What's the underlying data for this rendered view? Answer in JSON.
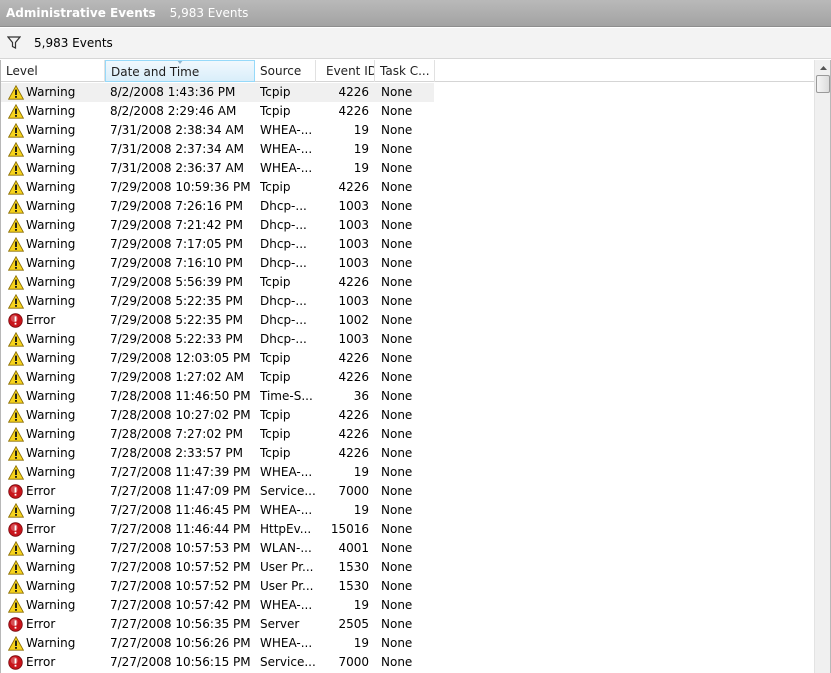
{
  "window": {
    "title": "Administrative Events",
    "event_count": "5,983 Events"
  },
  "filterbar": {
    "icon": "filter-icon",
    "count_label": "5,983 Events"
  },
  "table": {
    "columns": [
      "Level",
      "Date and Time",
      "Source",
      "Event ID",
      "Task C..."
    ],
    "sorted_column": "Date and Time",
    "rows": [
      {
        "level": "Warning",
        "date": "8/2/2008 1:43:36 PM",
        "source": "Tcpip",
        "id": "4226",
        "task": "None"
      },
      {
        "level": "Warning",
        "date": "8/2/2008 2:29:46 AM",
        "source": "Tcpip",
        "id": "4226",
        "task": "None"
      },
      {
        "level": "Warning",
        "date": "7/31/2008 2:38:34 AM",
        "source": "WHEA-...",
        "id": "19",
        "task": "None"
      },
      {
        "level": "Warning",
        "date": "7/31/2008 2:37:34 AM",
        "source": "WHEA-...",
        "id": "19",
        "task": "None"
      },
      {
        "level": "Warning",
        "date": "7/31/2008 2:36:37 AM",
        "source": "WHEA-...",
        "id": "19",
        "task": "None"
      },
      {
        "level": "Warning",
        "date": "7/29/2008 10:59:36 PM",
        "source": "Tcpip",
        "id": "4226",
        "task": "None"
      },
      {
        "level": "Warning",
        "date": "7/29/2008 7:26:16 PM",
        "source": "Dhcp-...",
        "id": "1003",
        "task": "None"
      },
      {
        "level": "Warning",
        "date": "7/29/2008 7:21:42 PM",
        "source": "Dhcp-...",
        "id": "1003",
        "task": "None"
      },
      {
        "level": "Warning",
        "date": "7/29/2008 7:17:05 PM",
        "source": "Dhcp-...",
        "id": "1003",
        "task": "None"
      },
      {
        "level": "Warning",
        "date": "7/29/2008 7:16:10 PM",
        "source": "Dhcp-...",
        "id": "1003",
        "task": "None"
      },
      {
        "level": "Warning",
        "date": "7/29/2008 5:56:39 PM",
        "source": "Tcpip",
        "id": "4226",
        "task": "None"
      },
      {
        "level": "Warning",
        "date": "7/29/2008 5:22:35 PM",
        "source": "Dhcp-...",
        "id": "1003",
        "task": "None"
      },
      {
        "level": "Error",
        "date": "7/29/2008 5:22:35 PM",
        "source": "Dhcp-...",
        "id": "1002",
        "task": "None"
      },
      {
        "level": "Warning",
        "date": "7/29/2008 5:22:33 PM",
        "source": "Dhcp-...",
        "id": "1003",
        "task": "None"
      },
      {
        "level": "Warning",
        "date": "7/29/2008 12:03:05 PM",
        "source": "Tcpip",
        "id": "4226",
        "task": "None"
      },
      {
        "level": "Warning",
        "date": "7/29/2008 1:27:02 AM",
        "source": "Tcpip",
        "id": "4226",
        "task": "None"
      },
      {
        "level": "Warning",
        "date": "7/28/2008 11:46:50 PM",
        "source": "Time-S...",
        "id": "36",
        "task": "None"
      },
      {
        "level": "Warning",
        "date": "7/28/2008 10:27:02 PM",
        "source": "Tcpip",
        "id": "4226",
        "task": "None"
      },
      {
        "level": "Warning",
        "date": "7/28/2008 7:27:02 PM",
        "source": "Tcpip",
        "id": "4226",
        "task": "None"
      },
      {
        "level": "Warning",
        "date": "7/28/2008 2:33:57 PM",
        "source": "Tcpip",
        "id": "4226",
        "task": "None"
      },
      {
        "level": "Warning",
        "date": "7/27/2008 11:47:39 PM",
        "source": "WHEA-...",
        "id": "19",
        "task": "None"
      },
      {
        "level": "Error",
        "date": "7/27/2008 11:47:09 PM",
        "source": "Service...",
        "id": "7000",
        "task": "None"
      },
      {
        "level": "Warning",
        "date": "7/27/2008 11:46:45 PM",
        "source": "WHEA-...",
        "id": "19",
        "task": "None"
      },
      {
        "level": "Error",
        "date": "7/27/2008 11:46:44 PM",
        "source": "HttpEv...",
        "id": "15016",
        "task": "None"
      },
      {
        "level": "Warning",
        "date": "7/27/2008 10:57:53 PM",
        "source": "WLAN-...",
        "id": "4001",
        "task": "None"
      },
      {
        "level": "Warning",
        "date": "7/27/2008 10:57:52 PM",
        "source": "User Pr...",
        "id": "1530",
        "task": "None"
      },
      {
        "level": "Warning",
        "date": "7/27/2008 10:57:52 PM",
        "source": "User Pr...",
        "id": "1530",
        "task": "None"
      },
      {
        "level": "Warning",
        "date": "7/27/2008 10:57:42 PM",
        "source": "WHEA-...",
        "id": "19",
        "task": "None"
      },
      {
        "level": "Error",
        "date": "7/27/2008 10:56:35 PM",
        "source": "Server",
        "id": "2505",
        "task": "None"
      },
      {
        "level": "Warning",
        "date": "7/27/2008 10:56:26 PM",
        "source": "WHEA-...",
        "id": "19",
        "task": "None"
      },
      {
        "level": "Error",
        "date": "7/27/2008 10:56:15 PM",
        "source": "Service...",
        "id": "7000",
        "task": "None"
      }
    ]
  },
  "colors": {
    "warning": "#f6d31d",
    "error": "#c8141b",
    "sorted_header": "#d9eefa"
  }
}
